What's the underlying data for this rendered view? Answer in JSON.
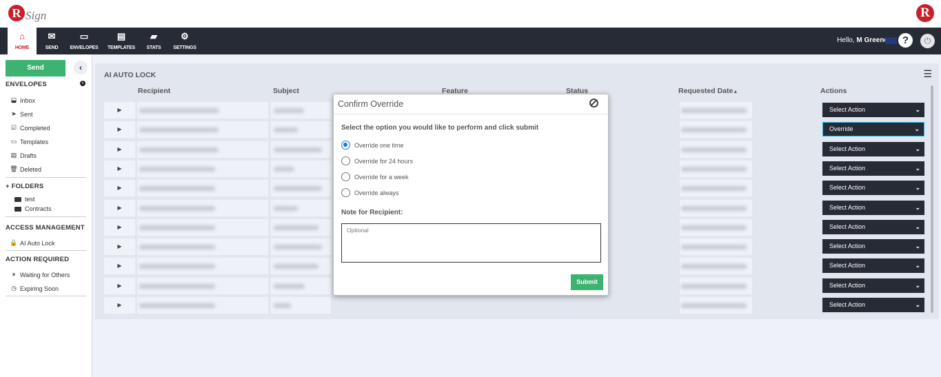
{
  "brand": {
    "logo_letter": "R",
    "logo_text": "Sign"
  },
  "nav": {
    "items": [
      {
        "label": "HOME",
        "icon": "home-icon"
      },
      {
        "label": "SEND",
        "icon": "envelope-icon"
      },
      {
        "label": "ENVELOPES",
        "icon": "inbox-tray-icon"
      },
      {
        "label": "TEMPLATES",
        "icon": "templates-icon"
      },
      {
        "label": "STATS",
        "icon": "briefcase-icon"
      },
      {
        "label": "SETTINGS",
        "icon": "gear-icon"
      }
    ],
    "greeting": "Hello,",
    "user": "M Greene"
  },
  "sidebar": {
    "send_label": "Send",
    "envelopes_title": "ENVELOPES",
    "envelopes": [
      {
        "label": "Inbox"
      },
      {
        "label": "Sent"
      },
      {
        "label": "Completed"
      },
      {
        "label": "Templates"
      },
      {
        "label": "Drafts"
      },
      {
        "label": "Deleted"
      }
    ],
    "folders_title": "FOLDERS",
    "folders": [
      {
        "label": "test"
      },
      {
        "label": "Contracts"
      }
    ],
    "access_title": "ACCESS MANAGEMENT",
    "access": [
      {
        "label": "AI Auto Lock"
      }
    ],
    "action_title": "ACTION REQUIRED",
    "action": [
      {
        "label": "Waiting for Others"
      },
      {
        "label": "Expiring Soon"
      }
    ]
  },
  "panel": {
    "title": "AI AUTO LOCK",
    "columns": [
      "Recipient",
      "Subject",
      "Feature",
      "Status",
      "Requested Date",
      "Actions"
    ],
    "sort_indicator": "▲",
    "rows": [
      {
        "action": "Select Action"
      },
      {
        "action": "Override"
      },
      {
        "action": "Select Action"
      },
      {
        "action": "Select Action"
      },
      {
        "action": "Select Action"
      },
      {
        "action": "Select Action"
      },
      {
        "action": "Select Action"
      },
      {
        "action": "Select Action"
      },
      {
        "action": "Select Action"
      },
      {
        "action": "Select Action"
      },
      {
        "action": "Select Action"
      }
    ]
  },
  "modal": {
    "title": "Confirm Override",
    "instruction": "Select the option you would like to perform and click submit",
    "options": [
      "Override one time",
      "Override for 24 hours",
      "Override for a week",
      "Override always"
    ],
    "selected_option": "Override one time",
    "note_label": "Note for Recipient:",
    "note_placeholder": "Optional",
    "note_value": "",
    "submit_label": "Submit"
  },
  "colors": {
    "nav_bg": "#262b35",
    "brand_red": "#c8202a",
    "primary_green": "#3cb371",
    "radio_blue": "#1a73e8",
    "focus_cyan": "#26b5e8"
  }
}
